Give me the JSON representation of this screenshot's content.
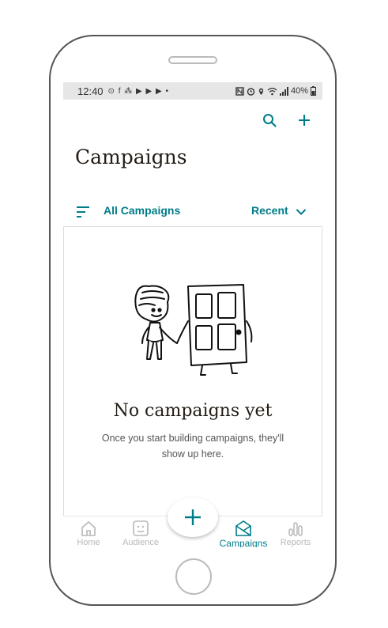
{
  "status_bar": {
    "time": "12:40",
    "left_icons": "⊙ f ⁂ ▶ ▶ ▶ •",
    "battery_percent": "40%"
  },
  "header": {
    "title": "Campaigns",
    "search_icon": "search-icon",
    "add_icon": "plus-icon"
  },
  "filter_bar": {
    "filter_label": "All Campaigns",
    "sort_label": "Recent"
  },
  "empty_state": {
    "title": "No campaigns yet",
    "body": "Once you start building campaigns, they'll show up here."
  },
  "tab_bar": {
    "tabs": [
      {
        "label": "Home",
        "icon": "home-icon",
        "active": false
      },
      {
        "label": "Audience",
        "icon": "audience-icon",
        "active": false
      },
      {
        "label": "Campaigns",
        "icon": "campaigns-icon",
        "active": true
      },
      {
        "label": "Reports",
        "icon": "reports-icon",
        "active": false
      }
    ],
    "fab_icon": "plus-icon"
  },
  "colors": {
    "accent": "#007c89",
    "title_text": "#241c15",
    "inactive_tab": "#b8b8b8"
  }
}
